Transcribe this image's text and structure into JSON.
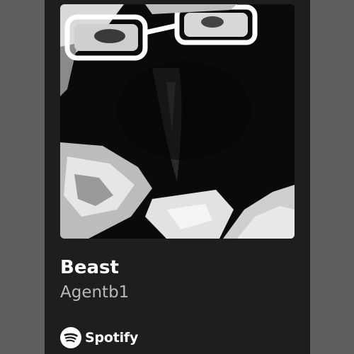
{
  "track": {
    "title": "Beast",
    "artist": "Agentb1"
  },
  "brand": {
    "name": "Spotify",
    "icon": "spotify-logo-icon"
  },
  "artwork": {
    "description_icon": "album-cover-art"
  },
  "colors": {
    "page_background": "#5f5f5f",
    "card_background": "#1e1e1e",
    "title": "#ffffff",
    "artist": "#b9b9b9"
  }
}
